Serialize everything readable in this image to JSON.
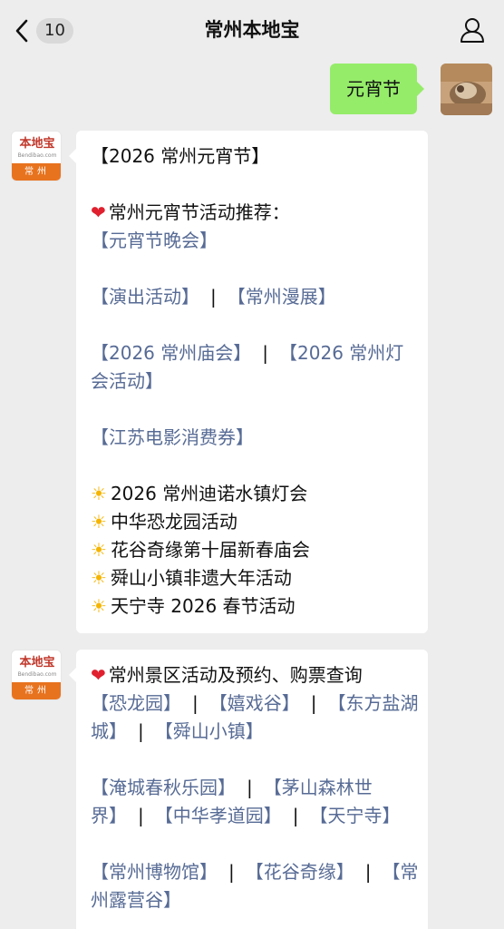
{
  "nav": {
    "badge_count": "10",
    "title": "常州本地宝"
  },
  "sent_message": {
    "text": "元宵节"
  },
  "logo": {
    "name": "本地宝",
    "url": "Bendibao.com",
    "city": "常州"
  },
  "message1": {
    "heading": "【2026 常州元宵节】",
    "rec_title": "常州元宵节活动推荐：",
    "link_gala": "【元宵节晚会】",
    "link_shows": "【演出活动】",
    "link_comic": "【常州漫展】",
    "link_fair": "【2026 常州庙会】",
    "link_lantern_a": "【2026 常州灯",
    "link_lantern_b": "会活动】",
    "link_coupon": "【江苏电影消费券】",
    "item1": "2026 常州迪诺水镇灯会",
    "item2": "中华恐龙园活动",
    "item3": "花谷奇缘第十届新春庙会",
    "item4": "舜山小镇非遗大年活动",
    "item5": "天宁寺 2026 春节活动"
  },
  "message2": {
    "heading": "常州景区活动及预约、购票查询",
    "link_dino": "【恐龙园】",
    "link_xixi": "【嬉戏谷】",
    "link_lake_a": "【东方盐湖",
    "link_lake_b": "城】",
    "link_shunshan": "【舜山小镇】",
    "link_yancheng": "【淹城春秋乐园】",
    "link_maoshan_a": "【茅山森林世",
    "link_maoshan_b": "界】",
    "link_xiaodao": "【中华孝道园】",
    "link_tianning": "【天宁寺】",
    "link_museum": "【常州博物馆】",
    "link_huagu": "【花谷奇缘】",
    "link_camp_a": "【常",
    "link_camp_b": "州露营谷】"
  },
  "separator": "|",
  "colors": {
    "link": "#576b95",
    "sent_bubble": "#95ec69",
    "background": "#ededed",
    "logo_orange": "#e8731f"
  }
}
